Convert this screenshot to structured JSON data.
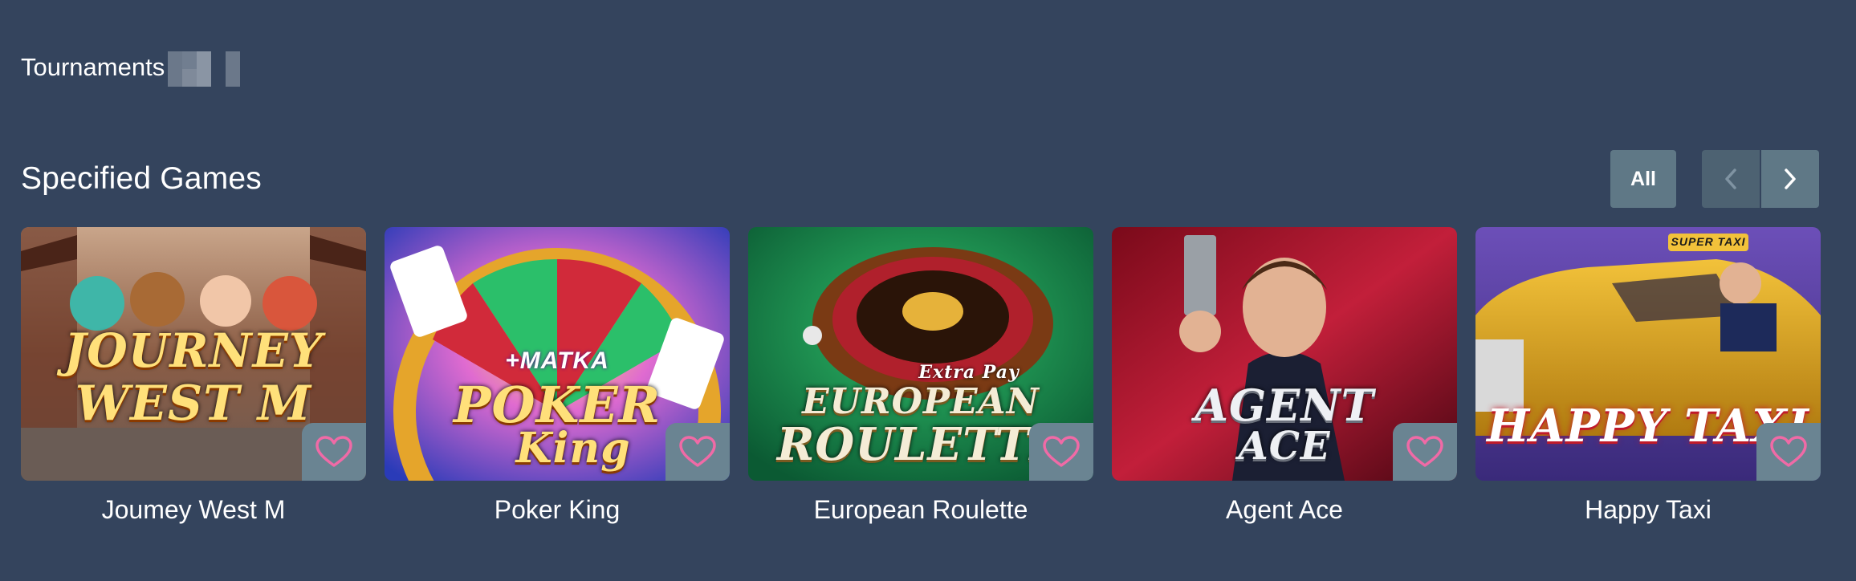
{
  "header": {
    "title": "Tournaments"
  },
  "section": {
    "title": "Specified Games",
    "all_label": "All",
    "icons": {
      "prev": "chevron-left-icon",
      "next": "chevron-right-icon",
      "favorite": "heart-icon"
    }
  },
  "games": [
    {
      "name": "Joumey West M",
      "art_line1": "JOURNEY",
      "art_line2": "WEST M"
    },
    {
      "name": "Poker King",
      "art_line1": "POKER",
      "art_line2": "King",
      "art_badge": "+MATKA"
    },
    {
      "name": "European Roulette",
      "art_line1": "EUROPEAN",
      "art_line2": "ROULETTE",
      "art_badge": "Extra Pay"
    },
    {
      "name": "Agent Ace",
      "art_line1": "AGENT",
      "art_line2": "ACE"
    },
    {
      "name": "Happy Taxi",
      "art_line1": "HAPPY TAXI",
      "art_badge": "SUPER TAXI"
    }
  ],
  "colors": {
    "background": "#34445d",
    "button": "#5f7886",
    "heart": "#f06aa6"
  }
}
